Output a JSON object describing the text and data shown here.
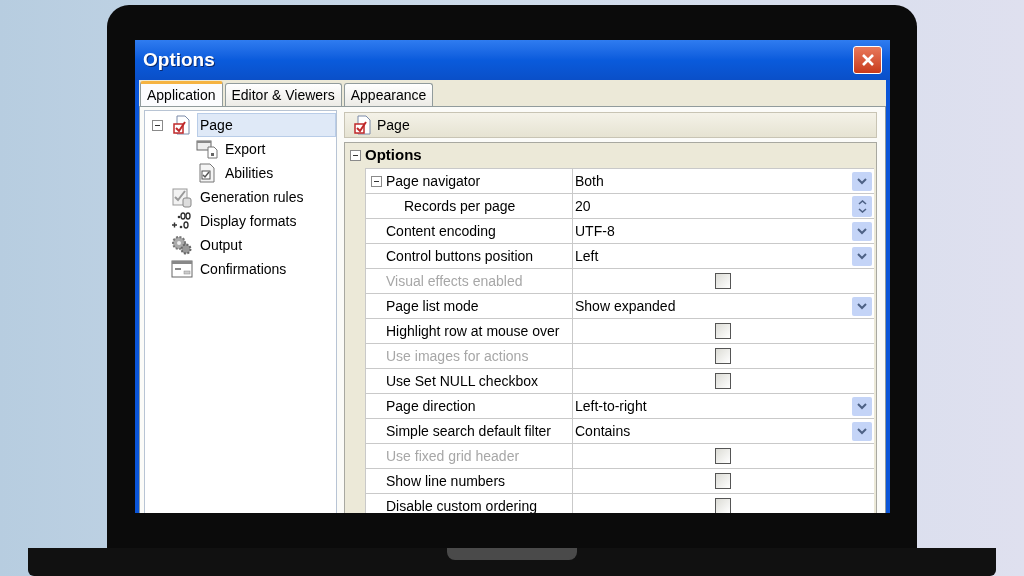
{
  "window": {
    "title": "Options"
  },
  "tabs": [
    {
      "label": "Application",
      "selected": true
    },
    {
      "label": "Editor & Viewers",
      "selected": false
    },
    {
      "label": "Appearance",
      "selected": false
    }
  ],
  "tree": [
    {
      "label": "Page",
      "selected": true,
      "expanded": true,
      "children": [
        {
          "label": "Export",
          "selected": false
        },
        {
          "label": "Abilities",
          "selected": false
        }
      ]
    },
    {
      "label": "Generation rules",
      "selected": false
    },
    {
      "label": "Display formats",
      "selected": false
    },
    {
      "label": "Output",
      "selected": false
    },
    {
      "label": "Confirmations",
      "selected": false
    }
  ],
  "panel_header": {
    "title": "Page"
  },
  "properties": {
    "category": {
      "label": "Options",
      "expanded": true
    },
    "rows": [
      {
        "label": "Page navigator",
        "kind": "dropdown",
        "value": "Both",
        "disabled": false,
        "expanded": true,
        "children": [
          {
            "label": "Records per page",
            "kind": "spin",
            "value": "20",
            "disabled": false
          }
        ]
      },
      {
        "label": "Content encoding",
        "kind": "dropdown",
        "value": "UTF-8",
        "disabled": false
      },
      {
        "label": "Control buttons position",
        "kind": "dropdown",
        "value": "Left",
        "disabled": false
      },
      {
        "label": "Visual effects enabled",
        "kind": "checkbox",
        "checked": false,
        "disabled": true
      },
      {
        "label": "Page list mode",
        "kind": "dropdown",
        "value": "Show expanded",
        "disabled": false
      },
      {
        "label": "Highlight row at mouse over",
        "kind": "checkbox",
        "checked": false,
        "disabled": false
      },
      {
        "label": "Use images for actions",
        "kind": "checkbox",
        "checked": false,
        "disabled": true
      },
      {
        "label": "Use Set NULL checkbox",
        "kind": "checkbox",
        "checked": false,
        "disabled": false
      },
      {
        "label": "Page direction",
        "kind": "dropdown",
        "value": "Left-to-right",
        "disabled": false
      },
      {
        "label": "Simple search default filter",
        "kind": "dropdown",
        "value": "Contains",
        "disabled": false
      },
      {
        "label": "Use fixed grid header",
        "kind": "checkbox",
        "checked": false,
        "disabled": true
      },
      {
        "label": "Show line numbers",
        "kind": "checkbox",
        "checked": false,
        "disabled": false
      },
      {
        "label": "Disable custom ordering",
        "kind": "checkbox",
        "checked": false,
        "disabled": false
      }
    ]
  }
}
